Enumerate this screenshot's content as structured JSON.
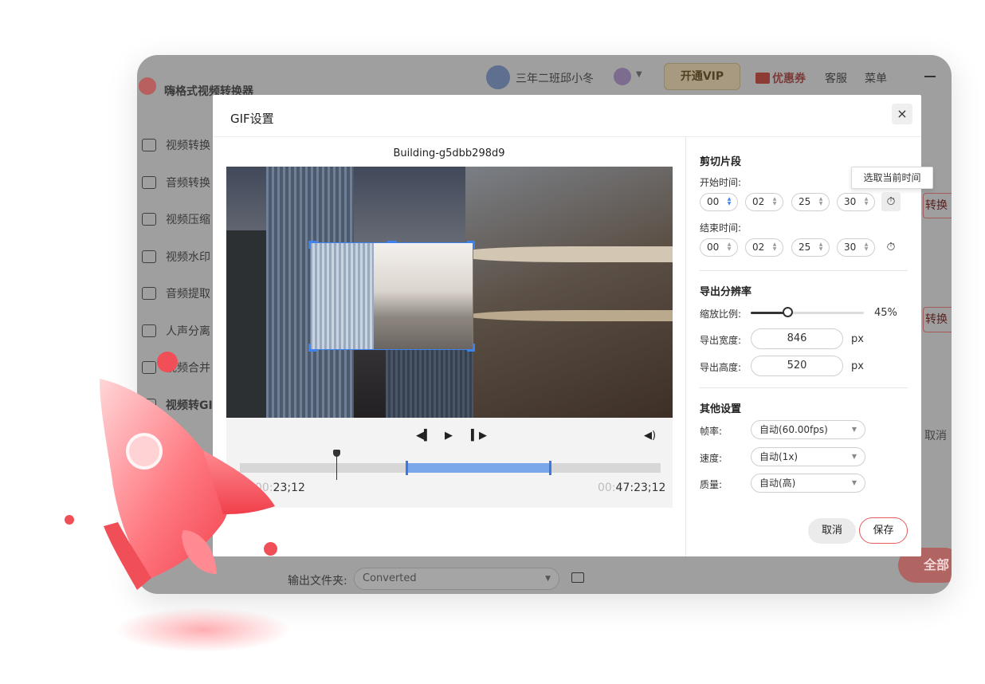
{
  "app": {
    "title": "嗨格式视频转换器",
    "user_name": "三年二班邱小冬",
    "open_vip": "开通VIP",
    "coupon": "优惠券",
    "service": "客服",
    "menu": "菜单"
  },
  "sidebar": {
    "items": [
      {
        "label": "视频转换"
      },
      {
        "label": "音频转换"
      },
      {
        "label": "视频压缩"
      },
      {
        "label": "视频水印"
      },
      {
        "label": "音频提取"
      },
      {
        "label": "人声分离"
      },
      {
        "label": "视频合并"
      },
      {
        "label": "视频转GIF"
      }
    ]
  },
  "background": {
    "convert_label_1": "转换",
    "convert_label_2": "转换",
    "cancel_label": "取消",
    "output_folder_label": "输出文件夹:",
    "output_folder_value": "Converted",
    "convert_all_label": "全部"
  },
  "dialog": {
    "title": "GIF设置",
    "close": "×",
    "video_name": "Building-g5dbb298d9",
    "player": {
      "time_start_dim": "00:",
      "time_start": "23;12",
      "time_end_dim": "00:",
      "time_end": "47:23;12"
    },
    "cut": {
      "title": "剪切片段",
      "start_label": "开始时间:",
      "end_label": "结束时间:",
      "start": [
        "00",
        "02",
        "25",
        "30"
      ],
      "end": [
        "00",
        "02",
        "25",
        "30"
      ],
      "tooltip": "选取当前时间"
    },
    "resolution": {
      "title": "导出分辨率",
      "scale_label": "缩放比例:",
      "scale_value": "45%",
      "scale_fraction": 0.45,
      "width_label": "导出宽度:",
      "width_value": "846",
      "height_label": "导出高度:",
      "height_value": "520",
      "unit": "px"
    },
    "other": {
      "title": "其他设置",
      "fps_label": "帧率:",
      "fps_value": "自动(60.00fps)",
      "speed_label": "速度:",
      "speed_value": "自动(1x)",
      "quality_label": "质量:",
      "quality_value": "自动(高)"
    },
    "buttons": {
      "cancel": "取消",
      "save": "保存"
    }
  }
}
